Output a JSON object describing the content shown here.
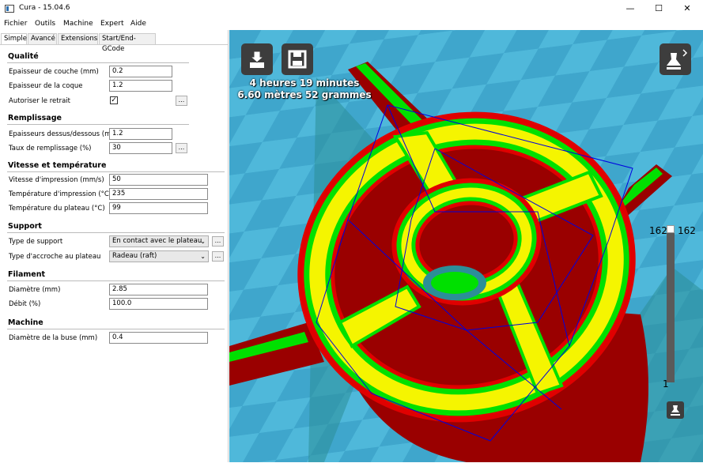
{
  "window": {
    "title": "Cura - 15.04.6",
    "minimize_glyph": "—",
    "maximize_glyph": "☐",
    "close_glyph": "✕"
  },
  "menu": [
    "Fichier",
    "Outils",
    "Machine",
    "Expert",
    "Aide"
  ],
  "tabs": [
    "Simple",
    "Avancé",
    "Extensions",
    "Start/End-GCode"
  ],
  "sections": {
    "qualite": {
      "title": "Qualité",
      "layer_height_label": "Epaisseur de couche (mm)",
      "layer_height_value": "0.2",
      "shell_label": "Epaisseur de la coque",
      "shell_value": "1.2",
      "retraction_label": "Autoriser le retrait",
      "retraction_checked": "✓"
    },
    "remplissage": {
      "title": "Remplissage",
      "topbottom_label": "Epaisseurs dessus/dessous (mm)",
      "topbottom_value": "1.2",
      "density_label": "Taux de remplissage (%)",
      "density_value": "30"
    },
    "vitesse": {
      "title": "Vitesse et température",
      "speed_label": "Vitesse d'impression (mm/s)",
      "speed_value": "50",
      "temp_label": "Température d'impression (°C)",
      "temp_value": "235",
      "bed_label": "Température du plateau (°C)",
      "bed_value": "99"
    },
    "support": {
      "title": "Support",
      "type_label": "Type de support",
      "type_value": "En contact avec le plateau",
      "adhesion_label": "Type d'accroche au plateau",
      "adhesion_value": "Radeau (raft)"
    },
    "filament": {
      "title": "Filament",
      "diameter_label": "Diamètre (mm)",
      "diameter_value": "2.85",
      "flow_label": "Débit (%)",
      "flow_value": "100.0"
    },
    "machine": {
      "title": "Machine",
      "nozzle_label": "Diamètre de la buse (mm)",
      "nozzle_value": "0.4"
    }
  },
  "ellipsis": "...",
  "viewport": {
    "time": "4 heures 19 minutes",
    "material": "6.60 mètres 52 grammes",
    "layer_max_left": "162",
    "layer_max_right": "162",
    "layer_min": "1",
    "colors": {
      "background": "#49b3d6",
      "outer_wall": "#e00000",
      "inner_wall": "#00e000",
      "skin": "#f5f500",
      "travel": "#0000e0",
      "dark_body": "#9a0000"
    },
    "icons": [
      "load-model-icon",
      "save-gcode-icon",
      "view-mode-icon",
      "layer-view-icon"
    ]
  }
}
